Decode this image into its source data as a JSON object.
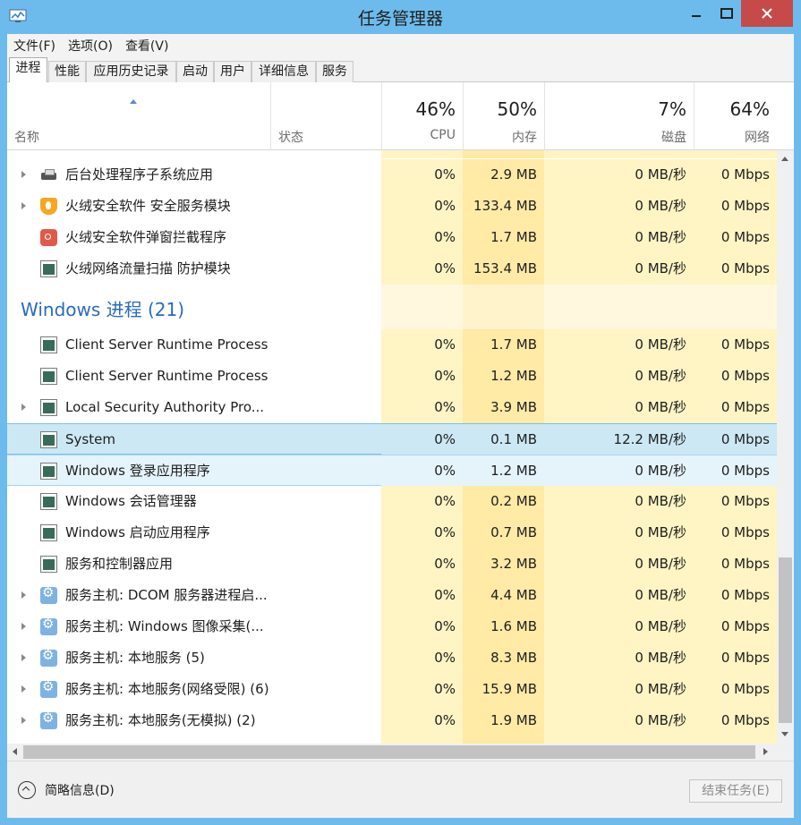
{
  "window": {
    "title": "任务管理器"
  },
  "menu": [
    "文件(F)",
    "选项(O)",
    "查看(V)"
  ],
  "tabs": [
    "进程",
    "性能",
    "应用历史记录",
    "启动",
    "用户",
    "详细信息",
    "服务"
  ],
  "header": {
    "name": "名称",
    "status": "状态",
    "cpu": {
      "pct": "46%",
      "label": "CPU"
    },
    "mem": {
      "pct": "50%",
      "label": "内存"
    },
    "disk": {
      "pct": "7%",
      "label": "磁盘"
    },
    "net": {
      "pct": "64%",
      "label": "网络"
    }
  },
  "group": {
    "title": "Windows 进程 (21)"
  },
  "rows_top": [
    {
      "name": "后台处理程序子系统应用",
      "cpu": "0%",
      "mem": "2.9 MB",
      "disk": "0 MB/秒",
      "net": "0 Mbps",
      "icon": "printer-icon",
      "expand": true
    },
    {
      "name": "火绒安全软件 安全服务模块",
      "cpu": "0%",
      "mem": "133.4 MB",
      "disk": "0 MB/秒",
      "net": "0 Mbps",
      "icon": "huorong-shield-icon",
      "expand": true
    },
    {
      "name": "火绒安全软件弹窗拦截程序",
      "cpu": "0%",
      "mem": "1.7 MB",
      "disk": "0 MB/秒",
      "net": "0 Mbps",
      "icon": "popup-block-icon",
      "expand": false
    },
    {
      "name": "火绒网络流量扫描 防护模块",
      "cpu": "0%",
      "mem": "153.4 MB",
      "disk": "0 MB/秒",
      "net": "0 Mbps",
      "icon": "window-app-icon",
      "expand": false
    }
  ],
  "rows_win": [
    {
      "name": "Client Server Runtime Process",
      "cpu": "0%",
      "mem": "1.7 MB",
      "disk": "0 MB/秒",
      "net": "0 Mbps",
      "icon": "window-app-icon",
      "expand": false
    },
    {
      "name": "Client Server Runtime Process",
      "cpu": "0%",
      "mem": "1.2 MB",
      "disk": "0 MB/秒",
      "net": "0 Mbps",
      "icon": "window-app-icon",
      "expand": false
    },
    {
      "name": "Local Security Authority Pro...",
      "cpu": "0%",
      "mem": "3.9 MB",
      "disk": "0 MB/秒",
      "net": "0 Mbps",
      "icon": "window-app-icon",
      "expand": true
    },
    {
      "name": "System",
      "cpu": "0%",
      "mem": "0.1 MB",
      "disk": "12.2 MB/秒",
      "net": "0 Mbps",
      "icon": "window-app-icon",
      "expand": false
    },
    {
      "name": "Windows 登录应用程序",
      "cpu": "0%",
      "mem": "1.2 MB",
      "disk": "0 MB/秒",
      "net": "0 Mbps",
      "icon": "window-app-icon",
      "expand": false
    },
    {
      "name": "Windows 会话管理器",
      "cpu": "0%",
      "mem": "0.2 MB",
      "disk": "0 MB/秒",
      "net": "0 Mbps",
      "icon": "window-app-icon",
      "expand": false
    },
    {
      "name": "Windows 启动应用程序",
      "cpu": "0%",
      "mem": "0.7 MB",
      "disk": "0 MB/秒",
      "net": "0 Mbps",
      "icon": "window-app-icon",
      "expand": false
    },
    {
      "name": "服务和控制器应用",
      "cpu": "0%",
      "mem": "3.2 MB",
      "disk": "0 MB/秒",
      "net": "0 Mbps",
      "icon": "window-app-icon",
      "expand": false
    },
    {
      "name": "服务主机: DCOM 服务器进程启...",
      "cpu": "0%",
      "mem": "4.4 MB",
      "disk": "0 MB/秒",
      "net": "0 Mbps",
      "icon": "gear-icon",
      "expand": true
    },
    {
      "name": "服务主机: Windows 图像采集(...",
      "cpu": "0%",
      "mem": "1.6 MB",
      "disk": "0 MB/秒",
      "net": "0 Mbps",
      "icon": "gear-icon",
      "expand": true
    },
    {
      "name": "服务主机: 本地服务 (5)",
      "cpu": "0%",
      "mem": "8.3 MB",
      "disk": "0 MB/秒",
      "net": "0 Mbps",
      "icon": "gear-icon",
      "expand": true
    },
    {
      "name": "服务主机: 本地服务(网络受限) (6)",
      "cpu": "0%",
      "mem": "15.9 MB",
      "disk": "0 MB/秒",
      "net": "0 Mbps",
      "icon": "gear-icon",
      "expand": true
    },
    {
      "name": "服务主机: 本地服务(无模拟) (2)",
      "cpu": "0%",
      "mem": "1.9 MB",
      "disk": "0 MB/秒",
      "net": "0 Mbps",
      "icon": "gear-icon",
      "expand": true
    }
  ],
  "selected_row": "System",
  "hover_row": "Windows 登录应用程序",
  "footer": {
    "fewer_details": "简略信息(D)",
    "end_task": "结束任务(E)"
  }
}
